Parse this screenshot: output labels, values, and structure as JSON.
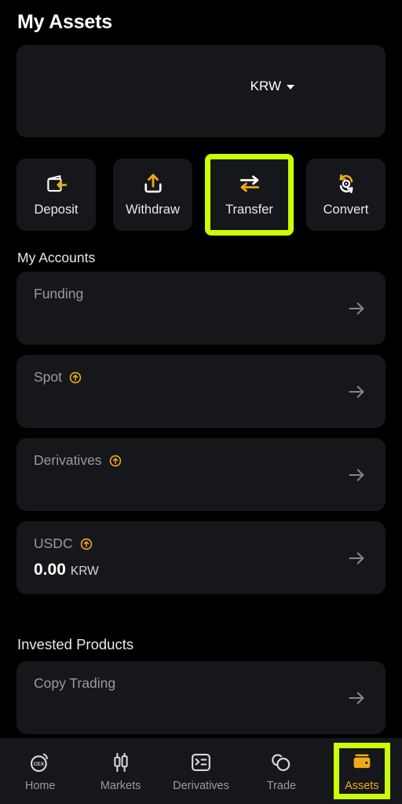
{
  "header": {
    "title": "My Assets"
  },
  "balance": {
    "currency": "KRW",
    "caret_icon": "chevron-down-icon"
  },
  "actions": [
    {
      "label": "Deposit",
      "icon": "wallet-deposit-icon",
      "highlighted": false
    },
    {
      "label": "Withdraw",
      "icon": "upload-withdraw-icon",
      "highlighted": false
    },
    {
      "label": "Transfer",
      "icon": "transfer-arrows-icon",
      "highlighted": true
    },
    {
      "label": "Convert",
      "icon": "convert-refresh-icon",
      "highlighted": false
    }
  ],
  "accounts_section": {
    "title": "My Accounts",
    "cards": [
      {
        "name": "Funding",
        "badge": false,
        "amount": "",
        "unit": "",
        "arrow_icon": "arrow-right-icon"
      },
      {
        "name": "Spot",
        "badge": true,
        "amount": "",
        "unit": "",
        "arrow_icon": "arrow-right-icon"
      },
      {
        "name": "Derivatives",
        "badge": true,
        "amount": "",
        "unit": "",
        "arrow_icon": "arrow-right-icon"
      },
      {
        "name": "USDC",
        "badge": true,
        "amount": "0.00",
        "unit": "KRW",
        "arrow_icon": "arrow-right-icon"
      }
    ]
  },
  "invested_section": {
    "title": "Invested Products",
    "cards": [
      {
        "name": "Copy Trading",
        "badge": false,
        "amount": "",
        "unit": "",
        "arrow_icon": "arrow-right-icon"
      }
    ]
  },
  "bottom_nav": {
    "items": [
      {
        "label": "Home",
        "icon": "cex-circle-icon",
        "active": false
      },
      {
        "label": "Markets",
        "icon": "candlestick-icon",
        "active": false
      },
      {
        "label": "Derivatives",
        "icon": "list-terminal-icon",
        "active": false
      },
      {
        "label": "Trade",
        "icon": "two-circles-icon",
        "active": false
      },
      {
        "label": "Assets",
        "icon": "wallet-filled-icon",
        "active": true
      }
    ],
    "highlighted_index": 4
  },
  "colors": {
    "page_background": "#000000",
    "card_background": "#16171B",
    "accent_orange": "#F0A91B",
    "highlight_green": "#CBFF06",
    "text_primary": "#FFFFFF",
    "text_muted": "#9A9BA2"
  }
}
